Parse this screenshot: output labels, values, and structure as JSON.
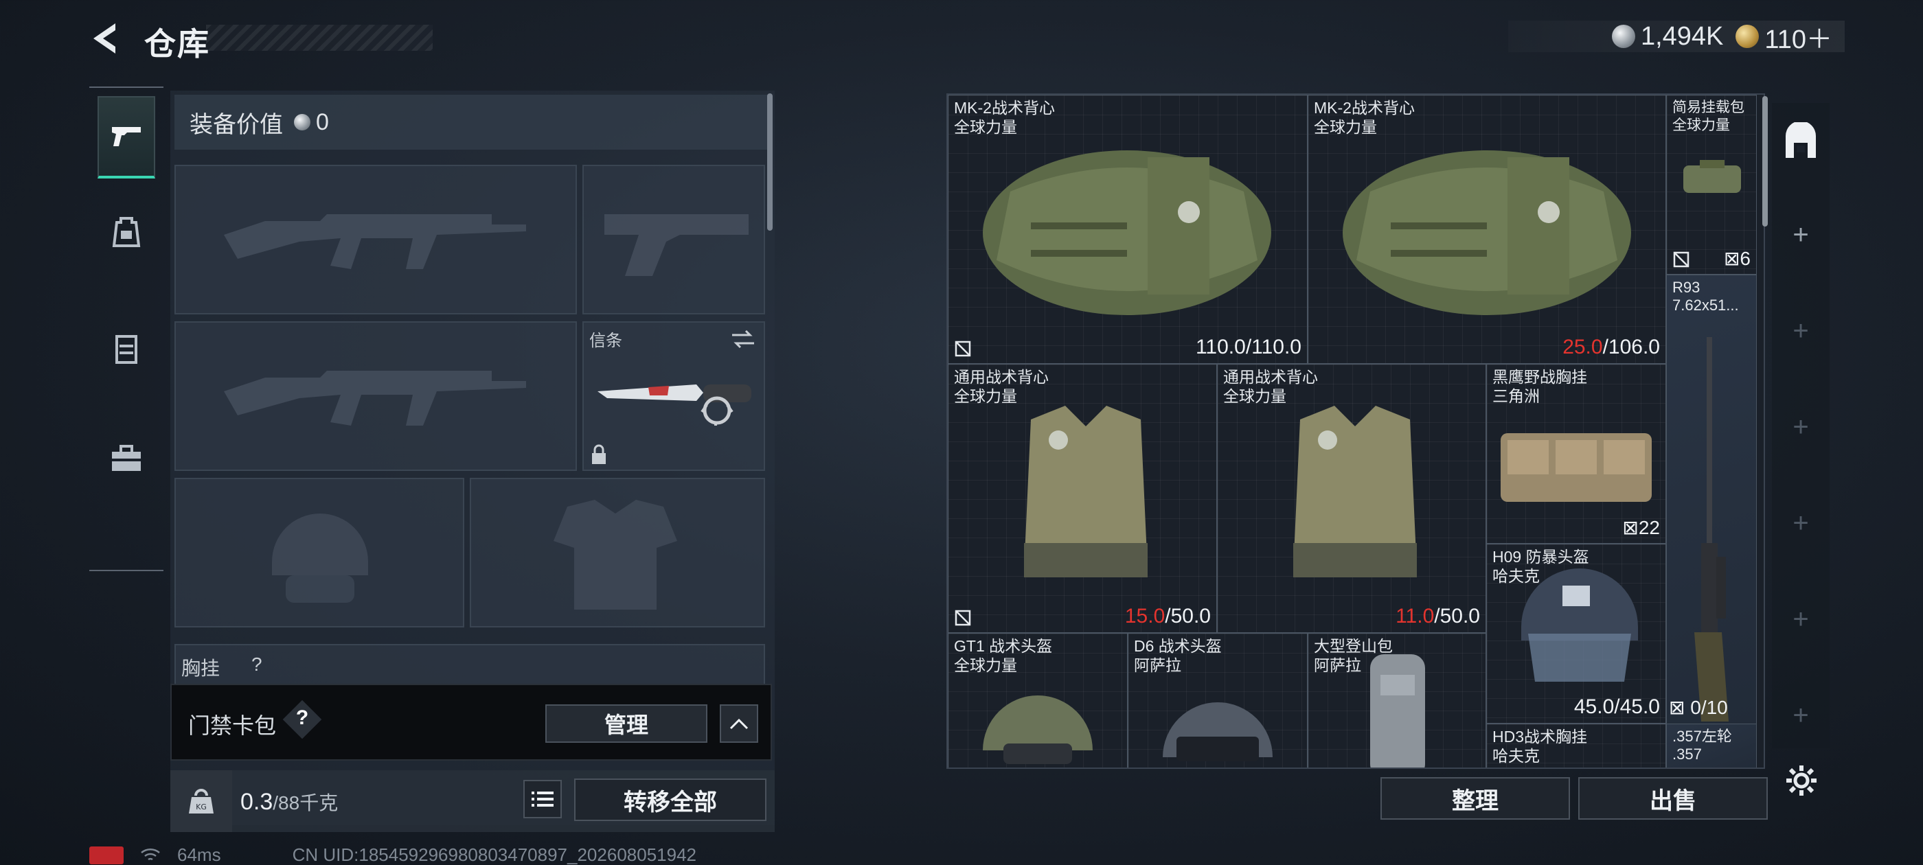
{
  "header": {
    "title": "仓库",
    "silver_amount": "1,494K",
    "gold_amount": "110＋",
    "corner_text": "?"
  },
  "nav": {
    "categories": [
      "weapons",
      "backpack",
      "vest",
      "toolbox"
    ]
  },
  "equipment": {
    "value_label": "装备价值",
    "value_amount": "0",
    "melee_slot_label": "信条",
    "chest_rig_label": "胸挂",
    "chest_rig_count": "?"
  },
  "access_card": {
    "label": "门禁卡包",
    "help": "?",
    "manage": "管理"
  },
  "weight": {
    "current": "0.3",
    "capacity": "/88千克",
    "transfer_all": "转移全部"
  },
  "status": {
    "ping": "64ms",
    "uid": "CN UID:185459296980803470897_202608051942"
  },
  "storage": {
    "items": [
      {
        "name": "MK-2战术背心",
        "sub": "全球力量",
        "durability_current": "110.0",
        "durability_max": "/110.0",
        "damaged": false
      },
      {
        "name": "MK-2战术背心",
        "sub": "全球力量",
        "durability_current": "25.0",
        "durability_max": "/106.0",
        "damaged": true
      },
      {
        "name": "简易挂载包",
        "sub": "全球力量",
        "count": "6"
      },
      {
        "name": "R93",
        "sub": "7.62x51..."
      },
      {
        "name": "通用战术背心",
        "sub": "全球力量",
        "durability_current": "15.0",
        "durability_max": "/50.0",
        "damaged": true
      },
      {
        "name": "通用战术背心",
        "sub": "全球力量",
        "durability_current": "11.0",
        "durability_max": "/50.0",
        "damaged": true
      },
      {
        "name": "黑鹰野战胸挂",
        "sub": "三角洲",
        "count": "22"
      },
      {
        "name": "H09 防暴头盔",
        "sub": "哈夫克",
        "durability_current": "45.0",
        "durability_max": "/45.0",
        "damaged": false
      },
      {
        "name": "GT1 战术头盔",
        "sub": "全球力量"
      },
      {
        "name": "D6 战术头盔",
        "sub": "阿萨拉"
      },
      {
        "name": "大型登山包",
        "sub": "阿萨拉"
      },
      {
        "name": "HD3战术胸挂",
        "sub": "哈夫克"
      },
      {
        "name": ".357左轮",
        "sub": ".357",
        "count": "0/10"
      }
    ]
  },
  "actions": {
    "sort": "整理",
    "sell": "出售"
  },
  "colors": {
    "accent_teal": "#3ad6b2",
    "damaged_red": "#e4342e",
    "item_rarity_purple": "#2b3550",
    "item_rarity_green": "#1f3a34",
    "item_rarity_orange": "#5e4a3a"
  }
}
